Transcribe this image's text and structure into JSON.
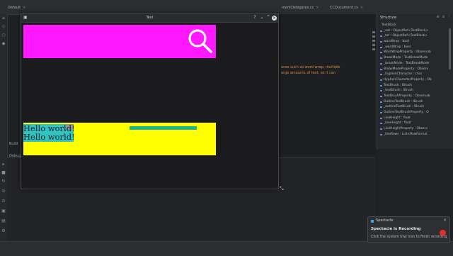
{
  "ide": {
    "tabs": [
      {
        "label": "Default"
      },
      {
        "label": "mentDelegates.cs"
      },
      {
        "label": "CCDocument.cs"
      }
    ],
    "editor_lines": [
      "aces such as word wrap, multiple",
      "arge amounts of text, so it can"
    ],
    "bottom_labels": {
      "build": "Build",
      "debug": "Debug"
    },
    "structure": {
      "title": "Structure",
      "items": [
        "TextBlock",
        "_ext : ObjectRef<TextBlock>",
        "_txt : ObjectRef<TextBlock>",
        "wordWrap : bool",
        "_wordWrap : bool",
        "WordWrapProperty : Observab",
        "BreakMode : TextBreakMode",
        "_breakMode : TextBreakMode",
        "BreakModeProperty : Observ",
        "_hyphenCharacter : char",
        "HyphenCharacterProperty : Ob",
        "TextBrush : IBrush",
        "_textBrush : IBrush",
        "TextBrushProperty : Observab",
        "OutlineTextBrush : IBrush",
        "_outlineTextBrush : IBrush",
        "OutlineTextBrushProperty : O",
        "LineHeight : float",
        "_lineHeight : float",
        "LineHeightProperty : Observ",
        "_lineRows : List<RowFormat"
      ]
    }
  },
  "window": {
    "title": "Test",
    "icon": "app-window-icon",
    "buttons": {
      "help": "?",
      "minimize": "⌄",
      "maximize": "^",
      "close": "×"
    },
    "search_panel_color": "#ff19ff",
    "text_panel_color": "#ffff00",
    "hello_lines": [
      "Hello world!",
      "Hello world!"
    ]
  },
  "notification": {
    "app": "Spectacle",
    "close": "×",
    "title": "Spectacle is Recording",
    "body": "Click the system tray icon to finish recording",
    "record_color": "#e0302d"
  }
}
